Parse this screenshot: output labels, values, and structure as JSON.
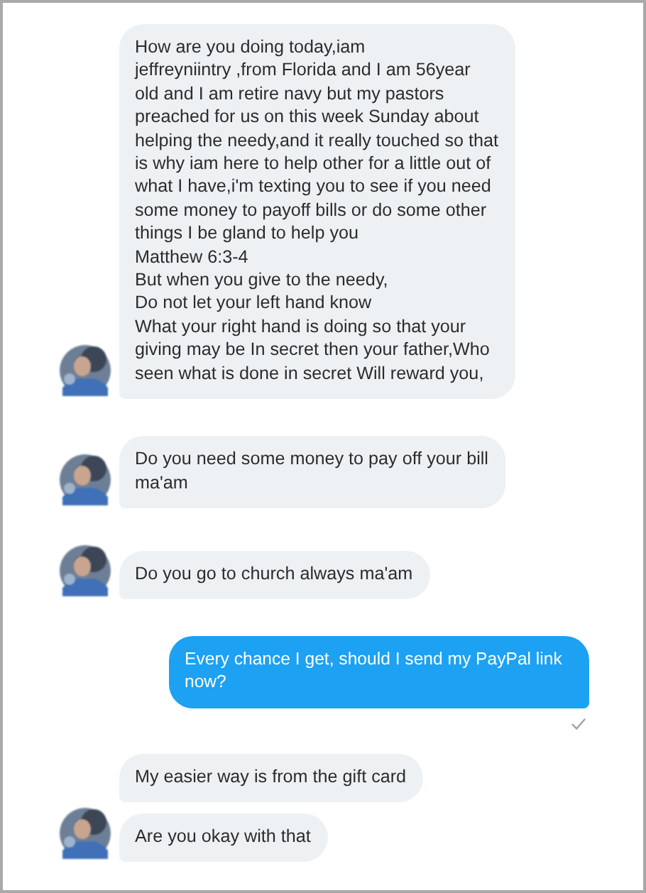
{
  "messages": [
    {
      "kind": "incoming",
      "avatar": true,
      "text": "How are you doing today,iam\njeffreyniintry  ,from Florida and I am 56year\nold and I am retire navy but my pastors\npreached for us on this week Sunday about\nhelping the needy,and it really touched so that\nis why iam here to help other for a little out of\nwhat I have,i'm texting you to see if you need\nsome money to payoff bills or do some other\nthings I be gland to help you\nMatthew 6:3-4\nBut when you give to the needy,\nDo not let your left hand know\nWhat your right hand is doing so that your\ngiving may be In secret then your father,Who\nseen what is done in secret Will reward you,"
    },
    {
      "kind": "incoming",
      "avatar": true,
      "text": "Do you need some money to pay off your bill\nma'am"
    },
    {
      "kind": "incoming",
      "avatar": true,
      "text": "Do you go to church always ma'am"
    },
    {
      "kind": "outgoing",
      "delivered": true,
      "text": "Every chance I get, should I send my PayPal link\nnow?"
    },
    {
      "kind": "incoming",
      "avatar": false,
      "text": "My easier way is from the gift card"
    },
    {
      "kind": "incoming",
      "avatar": true,
      "text": "Are you okay with that"
    }
  ]
}
